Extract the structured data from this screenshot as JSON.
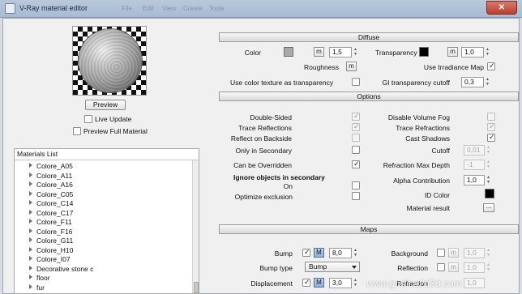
{
  "window": {
    "title": "V-Ray material editor",
    "ghost_menu": [
      "File",
      "Edit",
      "View",
      "Create",
      "Tools"
    ],
    "close_glyph": "✕"
  },
  "preview": {
    "button_label": "Preview",
    "live_update_label": "Live Update",
    "live_update_checked": false,
    "full_material_label": "Preview Full Material",
    "full_material_checked": false
  },
  "materials_list": {
    "header": "Materials List",
    "items": [
      "Colore_A05",
      "Colore_A11",
      "Colore_A16",
      "Colore_C05",
      "Colore_C14",
      "Colore_C17",
      "Colore_F11",
      "Colore_F16",
      "Colore_G11",
      "Colore_H10",
      "Colore_I07",
      "Decorative stone c",
      "floor",
      "fur"
    ]
  },
  "diffuse": {
    "header": "Diffuse",
    "color_label": "Color",
    "color_swatch": "#a9a9a9",
    "color_map_label": "m",
    "color_value": "1,5",
    "transparency_label": "Transparency",
    "transparency_swatch": "#000000",
    "transparency_map_label": "m",
    "transparency_value": "1,0",
    "roughness_label": "Roughness",
    "roughness_map_label": "m",
    "irradiance_label": "Use Irradiance Map",
    "irradiance_checked": true,
    "texture_transparency_label": "Use color texture as transparency",
    "texture_transparency_checked": false,
    "gi_cutoff_label": "GI transparency cutoff",
    "gi_cutoff_value": "0,3"
  },
  "options": {
    "header": "Options",
    "double_sided": "Double-Sided",
    "double_sided_checked": true,
    "trace_reflections": "Trace Reflections",
    "trace_reflections_checked": true,
    "reflect_backside": "Reflect on Backside",
    "reflect_backside_checked": false,
    "only_secondary": "Only in Secondary",
    "only_secondary_checked": false,
    "can_override": "Can be Overridden",
    "can_override_checked": true,
    "ignore_secondary": "Ignore objects in secondary",
    "on_label": "On",
    "on_checked": false,
    "optimize_exclusion": "Optimize exclusion",
    "optimize_exclusion_checked": false,
    "disable_fog": "Disable Volume Fog",
    "disable_fog_checked": false,
    "trace_refractions": "Trace Refractions",
    "trace_refractions_checked": true,
    "cast_shadows": "Cast Shadows",
    "cast_shadows_checked": true,
    "cutoff_label": "Cutoff",
    "cutoff_value": "0,01",
    "refraction_depth_label": "Refraction Max Depth",
    "refraction_depth_value": "-1",
    "alpha_label": "Alpha Contribution",
    "alpha_value": "1,0",
    "id_color_label": "ID Color",
    "id_color_swatch": "#000000",
    "material_result_label": "Material result",
    "material_result_button": "..."
  },
  "maps": {
    "header": "Maps",
    "bump_label": "Bump",
    "bump_checked": true,
    "bump_map": "M",
    "bump_value": "8,0",
    "bump_type_label": "Bump type",
    "bump_type_value": "Bump",
    "displacement_label": "Displacement",
    "displacement_checked": true,
    "displacement_map": "M",
    "displacement_value": "3,0",
    "background_label": "Background",
    "background_checked": false,
    "background_map": "m",
    "background_value": "1,0",
    "reflection_label": "Reflection",
    "reflection_checked": false,
    "reflection_map": "m",
    "reflection_value": "1,0",
    "refraction_label": "Refraction",
    "refraction_value": "1,0"
  },
  "watermark": "www.grafica2d3d.com"
}
